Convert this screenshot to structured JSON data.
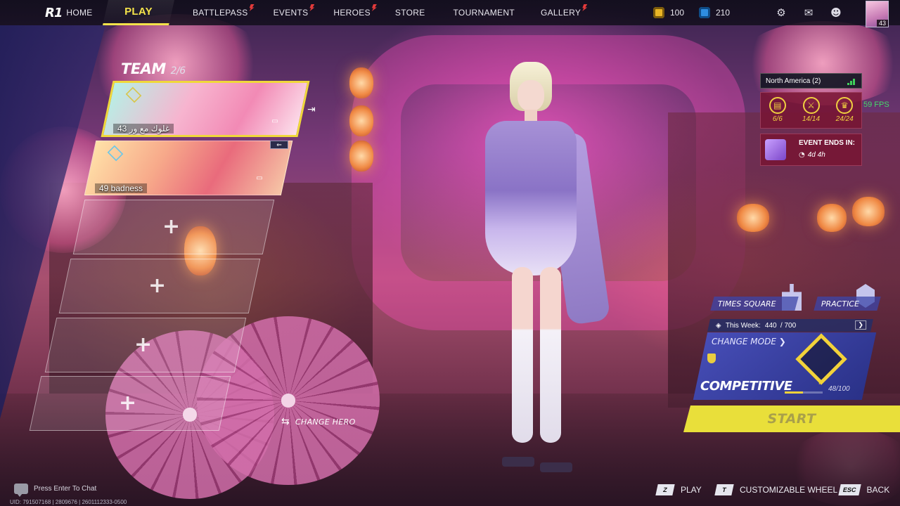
{
  "nav": {
    "brand": "R1",
    "home": "HOME",
    "play": "PLAY",
    "battlepass": "BATTLEPASS",
    "events": "EVENTS",
    "heroes": "HEROES",
    "store": "STORE",
    "tournament": "TOURNAMENT",
    "gallery": "GALLERY"
  },
  "currency": {
    "gold": "100",
    "gems": "210"
  },
  "profile": {
    "level": "43"
  },
  "team": {
    "title": "TEAM",
    "count": "2/6",
    "players": [
      {
        "name": "43 غلوك مع ور",
        "status_icon": "mic-icon"
      },
      {
        "name": "49 badness",
        "status_icon": "speaker-icon"
      }
    ]
  },
  "change_hero": "CHANGE HERO",
  "region": {
    "label": "North America (2)",
    "fps": "59 FPS"
  },
  "missions": [
    {
      "icon": "clipboard-icon",
      "symbol": "▤",
      "count": "6/6"
    },
    {
      "icon": "crossed-swords-icon",
      "symbol": "⚔",
      "count": "14/14"
    },
    {
      "icon": "trophy-icon",
      "symbol": "♛",
      "count": "24/24"
    }
  ],
  "event": {
    "title": "EVENT ENDS IN:",
    "time": "4d 4h"
  },
  "modes": {
    "times_square": "TIMES SQUARE",
    "practice": "PRACTICE",
    "this_week_label": "This Week:",
    "this_week_value": "440",
    "this_week_total": "/ 700",
    "change_mode": "CHANGE MODE ❯",
    "current_mode": "COMPETITIVE",
    "rank_tier": "II",
    "rank_progress": "48/100",
    "rank_progress_value": 0.48
  },
  "start": "START",
  "bottom": {
    "chat": "Press Enter To Chat",
    "uid": "UID: 791507168 | 2809676 | 2601112333-0500",
    "hints": [
      {
        "key": "Z",
        "label": "PLAY"
      },
      {
        "key": "T",
        "label": "CUSTOMIZABLE WHEEL"
      },
      {
        "key": "ESC",
        "label": "BACK"
      }
    ]
  },
  "colors": {
    "accent_yellow": "#f4e34a",
    "mode_blue": "#4650be",
    "event_red": "#78143a",
    "fps_green": "#46d96a"
  }
}
